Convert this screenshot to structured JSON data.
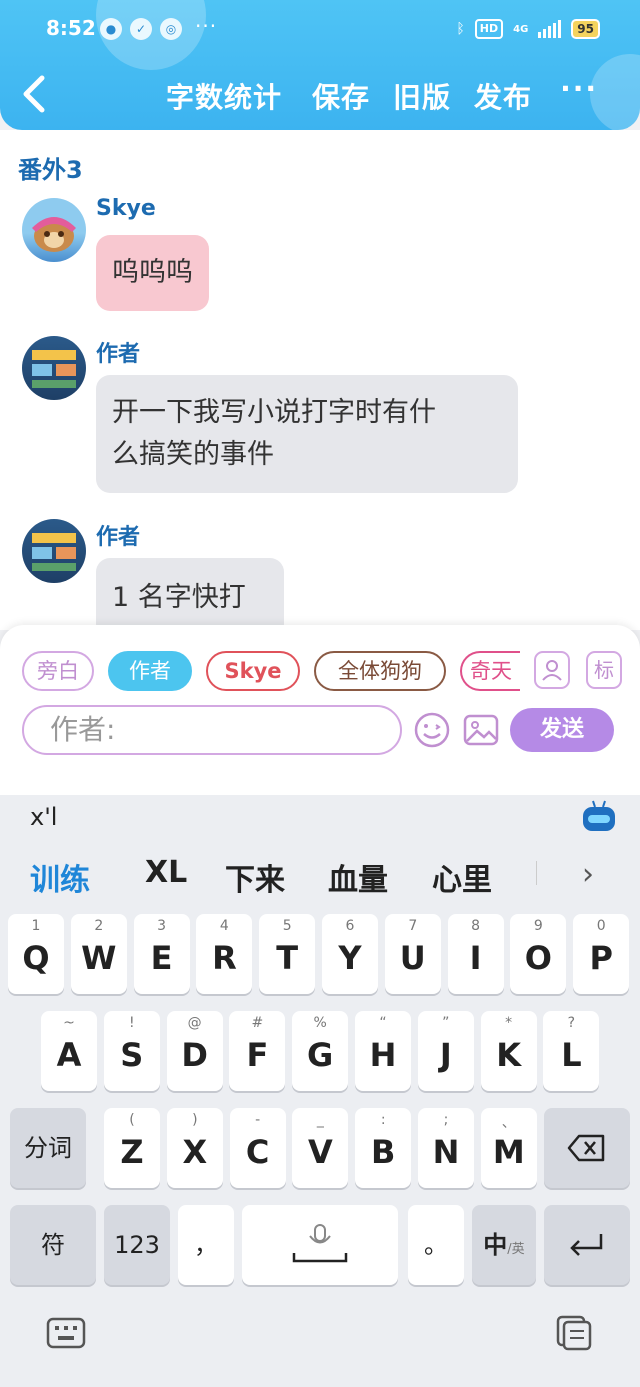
{
  "status_bar": {
    "time": "8:52",
    "more": "···",
    "network": "4G",
    "hd": "HD",
    "battery": "95"
  },
  "nav": {
    "title_items": [
      "字数统计",
      "保存",
      "旧版",
      "发布"
    ],
    "more": "···"
  },
  "chapter": "番外3",
  "messages": [
    {
      "speaker": "Skye",
      "text": "呜呜呜",
      "style": "pink"
    },
    {
      "speaker": "作者",
      "text_lines": [
        "开一下我写小说打字时有什",
        "么搞笑的事件"
      ],
      "style": "gray"
    },
    {
      "speaker": "作者",
      "text": "1 名字快打",
      "style": "gray"
    }
  ],
  "roles": [
    {
      "label": "旁白",
      "color": "#c08fd0"
    },
    {
      "label": "作者",
      "color": "#4cc5ef",
      "selected": true
    },
    {
      "label": "Skye",
      "color": "#e0525a"
    },
    {
      "label": "全体狗狗",
      "color": "#7a4a36"
    },
    {
      "label": "奇天",
      "color": "#e0508a"
    }
  ],
  "role_tools": {
    "person_icon": "person-add-icon",
    "tag_label": "标"
  },
  "input": {
    "placeholder": "作者:"
  },
  "send_label": "发送",
  "keyboard": {
    "pinyin": "x'l",
    "candidates": [
      "训练",
      "XL",
      "下来",
      "血量",
      "心里"
    ],
    "row1": [
      {
        "k": "Q",
        "s": "1"
      },
      {
        "k": "W",
        "s": "2"
      },
      {
        "k": "E",
        "s": "3"
      },
      {
        "k": "R",
        "s": "4"
      },
      {
        "k": "T",
        "s": "5"
      },
      {
        "k": "Y",
        "s": "6"
      },
      {
        "k": "U",
        "s": "7"
      },
      {
        "k": "I",
        "s": "8"
      },
      {
        "k": "O",
        "s": "9"
      },
      {
        "k": "P",
        "s": "0"
      }
    ],
    "row2": [
      {
        "k": "A",
        "s": "~"
      },
      {
        "k": "S",
        "s": "!"
      },
      {
        "k": "D",
        "s": "@"
      },
      {
        "k": "F",
        "s": "#"
      },
      {
        "k": "G",
        "s": "%"
      },
      {
        "k": "H",
        "s": "“"
      },
      {
        "k": "J",
        "s": "”"
      },
      {
        "k": "K",
        "s": "*"
      },
      {
        "k": "L",
        "s": "?"
      }
    ],
    "row3": [
      {
        "k": "Z",
        "s": "("
      },
      {
        "k": "X",
        "s": ")"
      },
      {
        "k": "C",
        "s": "-"
      },
      {
        "k": "V",
        "s": "_"
      },
      {
        "k": "B",
        "s": ":"
      },
      {
        "k": "N",
        "s": ";"
      },
      {
        "k": "M",
        "s": "、"
      }
    ],
    "fenci": "分词",
    "fu": "符",
    "num": "123",
    "comma": "，",
    "period": "。",
    "zh": "中",
    "zh_sub": "/英"
  }
}
